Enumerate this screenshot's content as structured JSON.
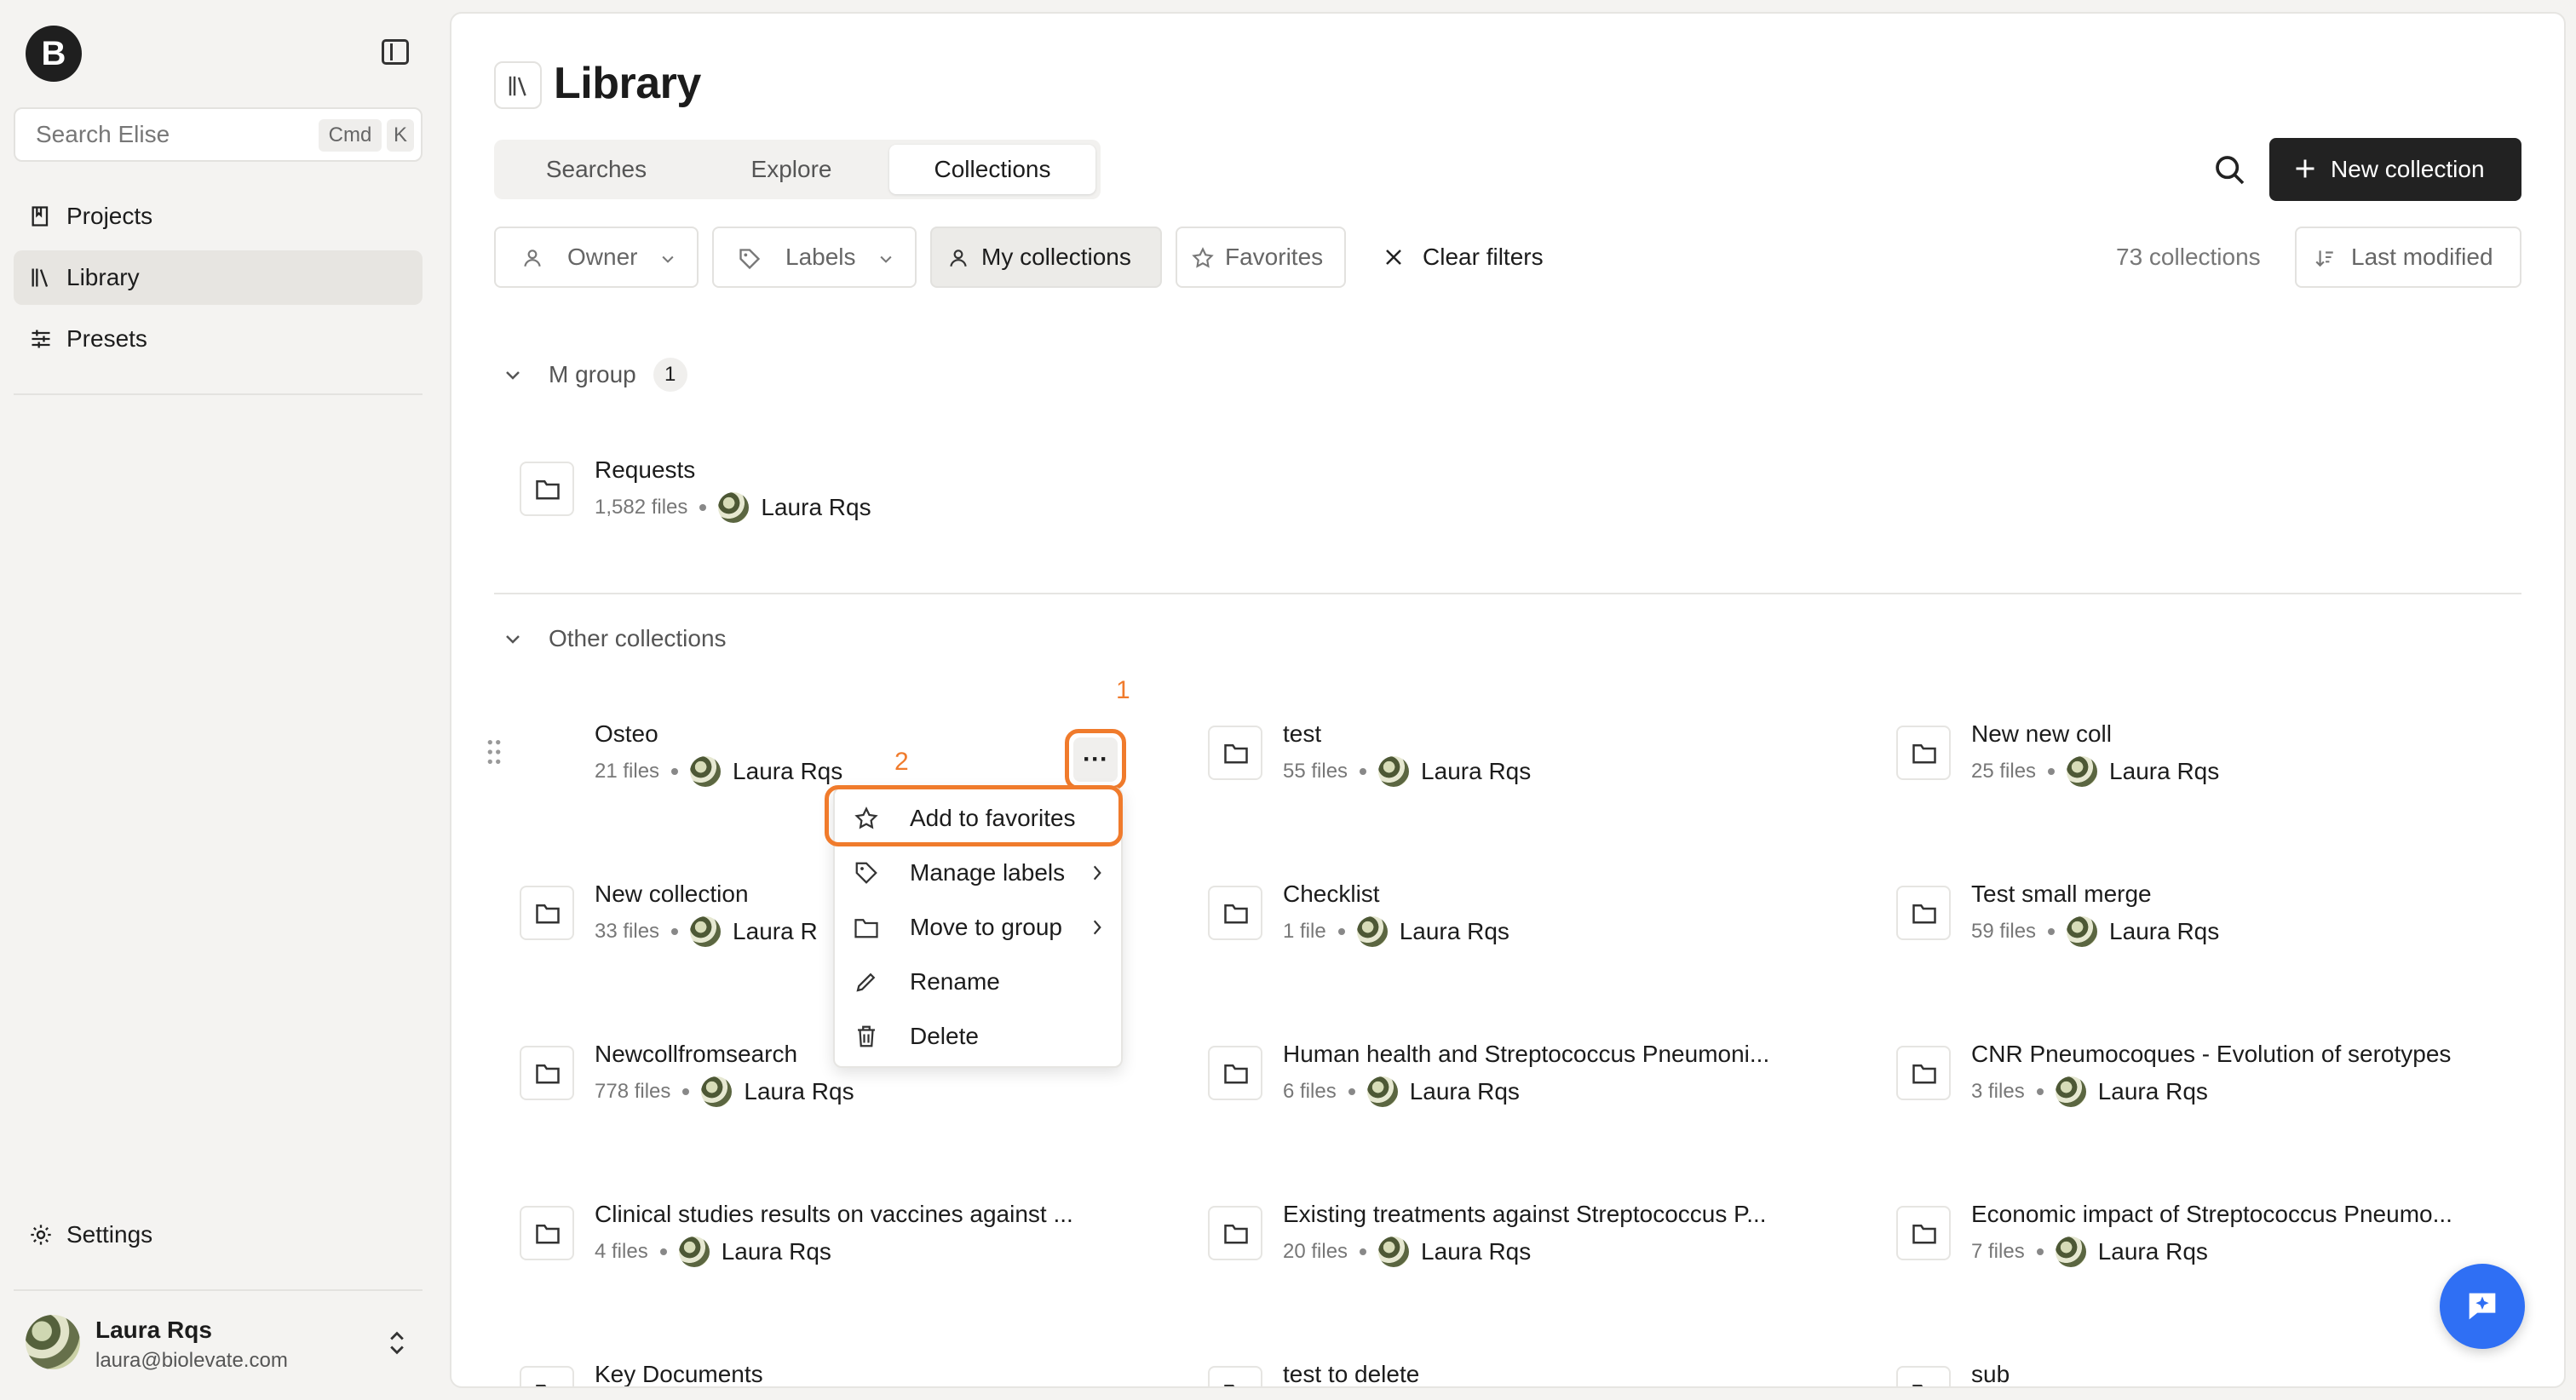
{
  "sidebar": {
    "logo_letter": "B",
    "search": {
      "placeholder": "Search Elise",
      "kbd1": "Cmd",
      "kbd2": "K"
    },
    "items": [
      {
        "label": "Projects",
        "icon": "book-icon"
      },
      {
        "label": "Library",
        "icon": "library-icon",
        "active": true
      },
      {
        "label": "Presets",
        "icon": "sliders-icon"
      }
    ],
    "settings_label": "Settings",
    "user": {
      "name": "Laura Rqs",
      "email": "laura@biolevate.com"
    }
  },
  "header": {
    "title": "Library",
    "tabs": [
      {
        "label": "Searches"
      },
      {
        "label": "Explore"
      },
      {
        "label": "Collections",
        "active": true
      }
    ],
    "new_collection_label": "New collection"
  },
  "filters": {
    "owner": "Owner",
    "labels": "Labels",
    "my_collections": "My collections",
    "favorites": "Favorites",
    "clear": "Clear filters",
    "count": "73 collections",
    "sort": "Last modified"
  },
  "groups": {
    "m_group": {
      "label": "M group",
      "count": "1"
    },
    "other": {
      "label": "Other collections"
    }
  },
  "collections": {
    "requests": {
      "name": "Requests",
      "files": "1,582 files",
      "owner": "Laura Rqs"
    },
    "grid": [
      {
        "name": "Osteo",
        "files": "21 files",
        "owner": "Laura Rqs"
      },
      {
        "name": "test",
        "files": "55 files",
        "owner": "Laura Rqs"
      },
      {
        "name": "New new coll",
        "files": "25 files",
        "owner": "Laura Rqs"
      },
      {
        "name": "New collection",
        "files": "33 files",
        "owner": "Laura R"
      },
      {
        "name": "Checklist",
        "files": "1 file",
        "owner": "Laura Rqs"
      },
      {
        "name": "Test small merge",
        "files": "59 files",
        "owner": "Laura Rqs"
      },
      {
        "name": "Newcollfromsearch",
        "files": "778 files",
        "owner": "Laura Rqs"
      },
      {
        "name": "Human health and Streptococcus Pneumoni...",
        "files": "6 files",
        "owner": "Laura Rqs"
      },
      {
        "name": "CNR Pneumocoques - Evolution of serotypes",
        "files": "3 files",
        "owner": "Laura Rqs"
      },
      {
        "name": "Clinical studies results on vaccines against ...",
        "files": "4 files",
        "owner": "Laura Rqs"
      },
      {
        "name": "Existing treatments against Streptococcus P...",
        "files": "20 files",
        "owner": "Laura Rqs"
      },
      {
        "name": "Economic impact of Streptococcus Pneumo...",
        "files": "7 files",
        "owner": "Laura Rqs"
      },
      {
        "name": "Key Documents",
        "files": "",
        "owner": ""
      },
      {
        "name": "test to delete",
        "files": "",
        "owner": ""
      },
      {
        "name": "sub",
        "files": "",
        "owner": ""
      }
    ]
  },
  "menu": {
    "items": [
      {
        "label": "Add to favorites"
      },
      {
        "label": "Manage labels"
      },
      {
        "label": "Move to group"
      },
      {
        "label": "Rename"
      },
      {
        "label": "Delete"
      }
    ],
    "dots": "···"
  },
  "annotations": {
    "step1": "1",
    "step2": "2",
    "color": "#f07b2c"
  }
}
